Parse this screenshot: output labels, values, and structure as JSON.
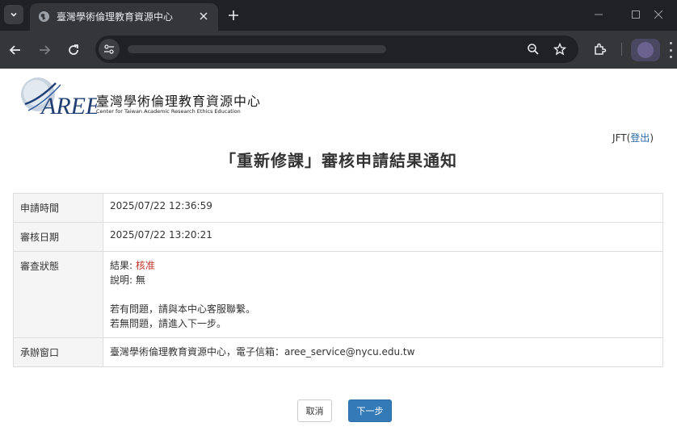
{
  "browser": {
    "tab_title": "臺灣學術倫理教育資源中心",
    "new_tab": "+"
  },
  "site": {
    "logo_text": "AREE",
    "name_zh": "臺灣學術倫理教育資源中心",
    "name_en": "Center for Taiwan Academic Research Ethics Education"
  },
  "user": {
    "name": "JFT",
    "open_paren": "(",
    "logout": "登出",
    "close_paren": ")"
  },
  "page": {
    "title": "「重新修課」審核申請結果通知"
  },
  "table": {
    "apply_time_label": "申請時間",
    "apply_time_value": "2025/07/22 12:36:59",
    "review_date_label": "審核日期",
    "review_date_value": "2025/07/22 13:20:21",
    "status_label": "審查狀態",
    "result_prefix": "結果: ",
    "result_value": "核准",
    "note_prefix": "說明: ",
    "note_value": "無",
    "msg_question": "若有問題，請與本中心客服聯繫。",
    "msg_no_question": "若無問題，請進入下一步。",
    "contact_label": "承辦窗口",
    "contact_value": "臺灣學術倫理教育資源中心，電子信箱：aree_service@nycu.edu.tw"
  },
  "buttons": {
    "cancel": "取消",
    "next": "下一步"
  },
  "colors": {
    "primary": "#337ab7",
    "approved": "#c0392b",
    "link": "#2a6aa8"
  }
}
